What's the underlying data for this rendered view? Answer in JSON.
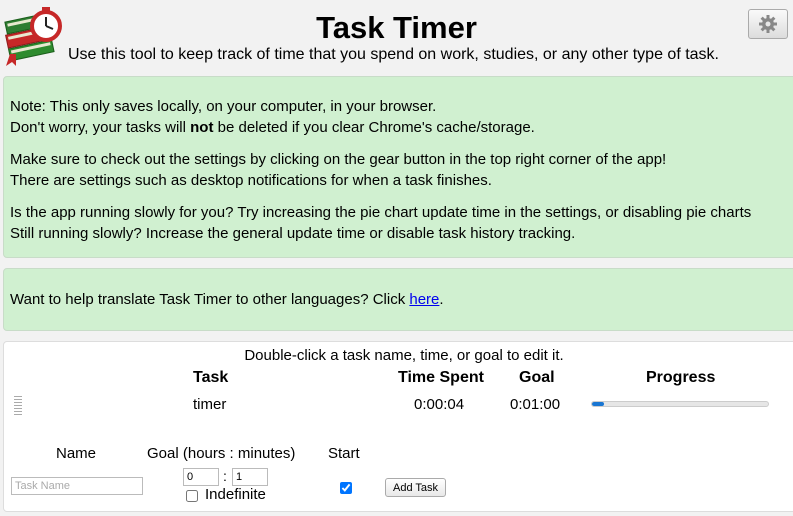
{
  "header": {
    "title": "Task Timer",
    "subtitle": "Use this tool to keep track of time that you spend on work, studies, or any other type of task."
  },
  "note": {
    "line1": "Note: This only saves locally, on your computer, in your browser.",
    "line2_a": "Don't worry, your tasks will ",
    "line2_b": "not",
    "line2_c": " be deleted if you clear Chrome's cache/storage.",
    "line3": "Make sure to check out the settings by clicking on the gear button in the top right corner of the app!",
    "line4": "There are settings such as desktop notifications for when a task finishes.",
    "line5": "Is the app running slowly for you? Try increasing the pie chart update time in the settings, or disabling pie charts",
    "line6": "Still running slowly? Increase the general update time or disable task history tracking."
  },
  "translate": {
    "text": "Want to help translate Task Timer to other languages? Click ",
    "link": "here",
    "end": "."
  },
  "tasks": {
    "hint": "Double-click a task name, time, or goal to edit it.",
    "columns": {
      "task": "Task",
      "time": "Time Spent",
      "goal": "Goal",
      "progress": "Progress"
    },
    "rows": [
      {
        "name": "timer",
        "time": "0:00:04",
        "goal": "0:01:00",
        "progress": 0.067
      }
    ]
  },
  "new_task": {
    "name_label": "Name",
    "goal_label": "Goal (hours : minutes)",
    "start_label": "Start",
    "name_placeholder": "Task Name",
    "hours_value": "0",
    "separator": ":",
    "minutes_value": "1",
    "indefinite_label": "Indefinite",
    "indefinite_checked": false,
    "start_checked": true,
    "add_button": "Add Task"
  },
  "icons": {
    "logo": "books-clock-logo",
    "settings": "gear-icon"
  },
  "colors": {
    "panel_bg": "#d0f0d0",
    "progress_fill": "#1976d2",
    "link": "#0000ee"
  }
}
